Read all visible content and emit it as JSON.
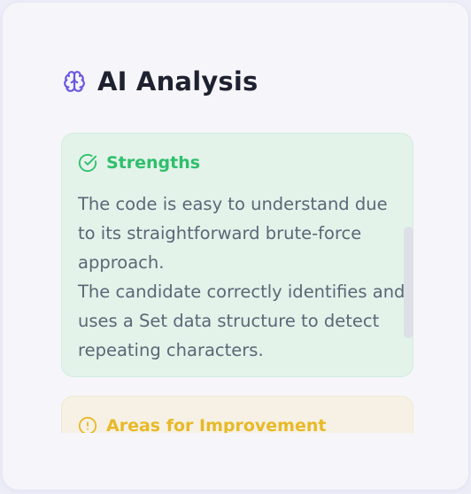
{
  "header": {
    "icon": "brain-icon",
    "title": "AI Analysis",
    "accent_color": "#6b57e0"
  },
  "strengths": {
    "icon": "check-circle-icon",
    "label": "Strengths",
    "color": "#2fbf6b",
    "paragraphs": [
      "The code is easy to understand due to its straightforward brute-force approach.",
      "The candidate correctly identifies and uses a Set data structure to detect repeating characters."
    ]
  },
  "improvements": {
    "icon": "alert-circle-icon",
    "label": "Areas for Improvement",
    "color": "#e8b928"
  }
}
